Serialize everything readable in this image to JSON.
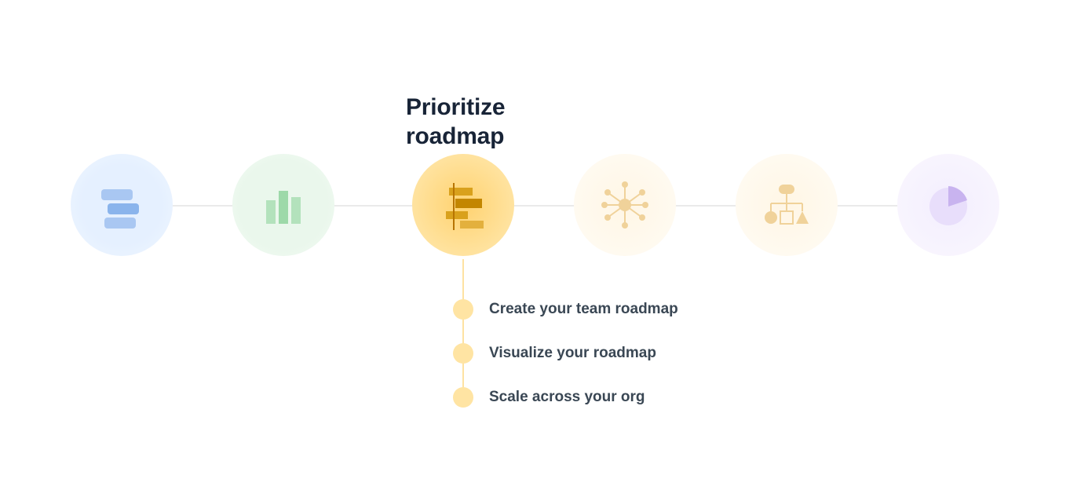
{
  "active_step": {
    "title_line1": "Prioritize",
    "title_line2": "roadmap"
  },
  "bullets": [
    {
      "label": "Create your team roadmap"
    },
    {
      "label": "Visualize your roadmap"
    },
    {
      "label": "Scale across your org"
    }
  ],
  "steps": [
    {
      "name": "step-1",
      "icon": "stacked-bars-icon",
      "color": "#a9c7f2"
    },
    {
      "name": "step-2",
      "icon": "bar-chart-icon",
      "color": "#b3e2bc"
    },
    {
      "name": "step-3",
      "icon": "gantt-icon",
      "color": "#d99a00",
      "active": true
    },
    {
      "name": "step-4",
      "icon": "network-icon",
      "color": "#f5d9a2"
    },
    {
      "name": "step-5",
      "icon": "org-shapes-icon",
      "color": "#f5d9a2"
    },
    {
      "name": "step-6",
      "icon": "pie-icon",
      "color": "#c8b3ef"
    }
  ],
  "colors": {
    "text": "#182437",
    "subtext": "#3a4754",
    "line": "#eaeaea",
    "bullet_dot": "#ffe4a3"
  }
}
